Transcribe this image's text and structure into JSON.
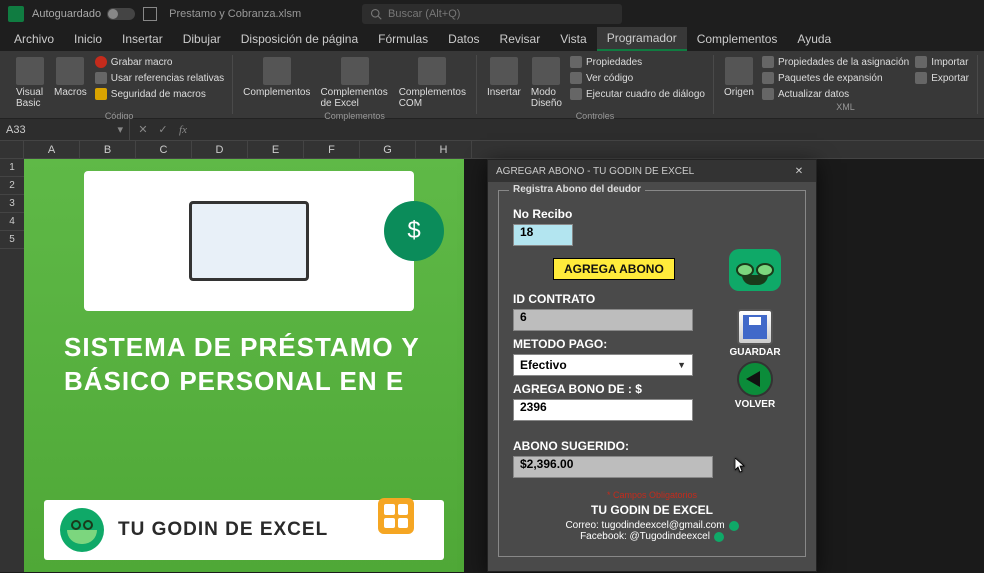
{
  "titlebar": {
    "autosave": "Autoguardado",
    "filename": "Prestamo y Cobranza.xlsm",
    "search_placeholder": "Buscar (Alt+Q)"
  },
  "tabs": [
    "Archivo",
    "Inicio",
    "Insertar",
    "Dibujar",
    "Disposición de página",
    "Fórmulas",
    "Datos",
    "Revisar",
    "Vista",
    "Programador",
    "Complementos",
    "Ayuda"
  ],
  "active_tab": "Programador",
  "ribbon": {
    "group1": {
      "visual_basic": "Visual Basic",
      "macros": "Macros",
      "grabar": "Grabar macro",
      "ref_rel": "Usar referencias relativas",
      "seguridad": "Seguridad de macros",
      "label": "Código"
    },
    "group2": {
      "compl": "Complementos",
      "compl_excel": "Complementos de Excel",
      "compl_com": "Complementos COM",
      "label": "Complementos"
    },
    "group3": {
      "insertar": "Insertar",
      "modo": "Modo Diseño",
      "prop": "Propiedades",
      "ver_cod": "Ver código",
      "ejecutar": "Ejecutar cuadro de diálogo",
      "label": "Controles"
    },
    "group4": {
      "origen": "Origen",
      "prop_asig": "Propiedades de la asignación",
      "paq_exp": "Paquetes de expansión",
      "act_datos": "Actualizar datos",
      "importar": "Importar",
      "exportar": "Exportar",
      "label": "XML"
    }
  },
  "namebox": "A33",
  "columns": [
    "A",
    "B",
    "C",
    "D",
    "E",
    "F",
    "G",
    "H"
  ],
  "rows": [
    "1",
    "2",
    "3",
    "4",
    "5"
  ],
  "promo": {
    "headline": "SISTEMA DE PRÉSTAMO Y BÁSICO PERSONAL EN E",
    "brand": "TU GODIN DE EXCEL"
  },
  "dialog": {
    "title": "AGREGAR ABONO - TU GODIN DE EXCEL",
    "legend": "Registra Abono del deudor",
    "no_recibo_label": "No Recibo",
    "no_recibo_value": "18",
    "agrega_abono_badge": "AGREGA ABONO",
    "id_contrato_label": "ID CONTRATO",
    "id_contrato_value": "6",
    "metodo_pago_label": "METODO PAGO:",
    "metodo_pago_value": "Efectivo",
    "agrega_bono_label": "AGREGA BONO DE : $",
    "agrega_bono_value": "2396",
    "abono_sugerido_label": "ABONO SUGERIDO:",
    "abono_sugerido_value": "$2,396.00",
    "guardar": "GUARDAR",
    "volver": "VOLVER",
    "campos_req": "* Campos Obligatorios",
    "brand": "TU GODIN DE EXCEL",
    "correo": "Correo: tugodindeexcel@gmail.com",
    "facebook": "Facebook: @Tugodindeexcel"
  }
}
